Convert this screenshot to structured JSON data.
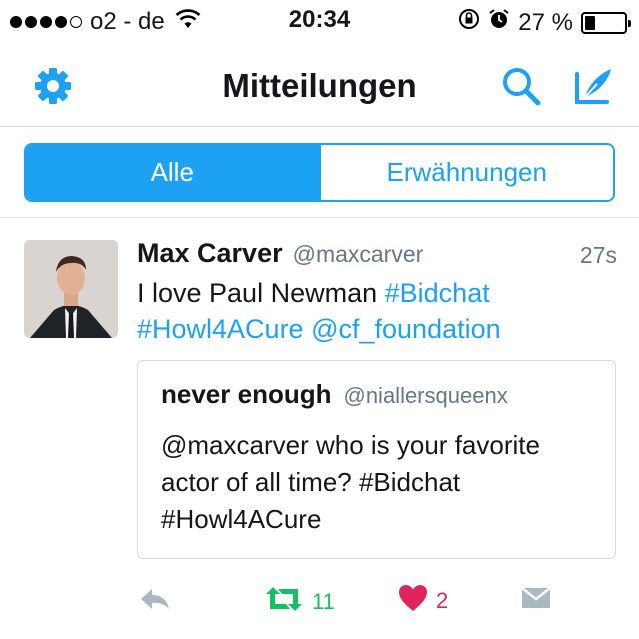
{
  "status_bar": {
    "carrier": "o2 - de",
    "time": "20:34",
    "battery_percent": "27 %",
    "battery_level": 0.27,
    "signal_bars": 4,
    "signal_max": 5
  },
  "nav": {
    "title": "Mitteilungen",
    "icons": [
      "gear-icon",
      "search-icon",
      "compose-icon"
    ]
  },
  "tabs": {
    "all_label": "Alle",
    "mentions_label": "Erwähnungen"
  },
  "tweet": {
    "name": "Max Carver",
    "handle": "@maxcarver",
    "time": "27s",
    "text_plain": "I love Paul Newman",
    "hashtag1": "#Bidchat",
    "hashtag2": "#Howl4ACure",
    "mention": "@cf_foundation",
    "quote": {
      "name": "never enough",
      "handle": "@niallersqueenx",
      "line1": "@maxcarver who is your favorite",
      "line2": "actor of all time? #Bidchat",
      "line3": "#Howl4ACure"
    },
    "retweet_count": "11",
    "like_count": "2"
  },
  "colors": {
    "accent": "#1da1f2",
    "retweet": "#17bf63",
    "like": "#e0245e",
    "muted": "#657786"
  }
}
